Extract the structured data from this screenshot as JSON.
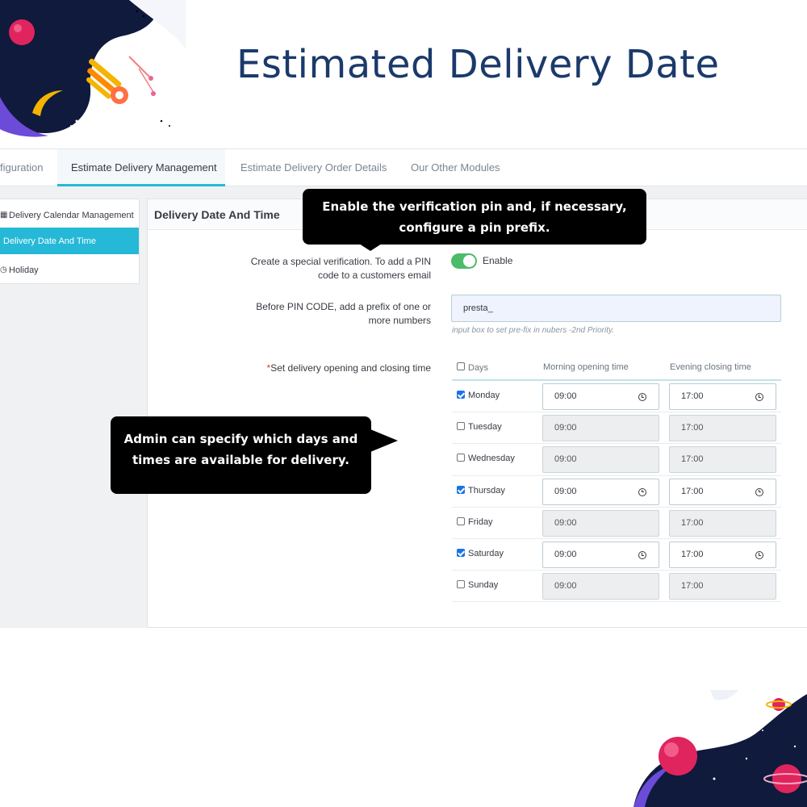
{
  "header": {
    "title": "Estimated Delivery Date"
  },
  "tabs": [
    {
      "label": "figuration",
      "active": false
    },
    {
      "label": "Estimate Delivery Management",
      "active": true
    },
    {
      "label": "Estimate Delivery Order Details",
      "active": false
    },
    {
      "label": "Our Other Modules",
      "active": false
    }
  ],
  "left_menu": [
    {
      "label": "Delivery Calendar Management",
      "icon": "calendar-icon",
      "active": false
    },
    {
      "label": "Delivery Date And Time",
      "icon": "",
      "active": true
    },
    {
      "label": "Holiday",
      "icon": "clock-icon",
      "active": false
    }
  ],
  "panel": {
    "title": "Delivery Date And Time",
    "verification": {
      "label_line1": "Create a special verification. To add a PIN",
      "label_line2": "code to a customers email",
      "toggle_text": "Enable",
      "enabled": true
    },
    "prefix": {
      "label_line1": "Before PIN CODE, add a prefix of one or",
      "label_line2": "more numbers",
      "value": "presta_",
      "help": "input box to set pre-fix in nubers -2nd Priority."
    },
    "schedule": {
      "required_mark": "*",
      "label": "Set delivery opening and closing time",
      "col_days": "Days",
      "col_morning": "Morning opening time",
      "col_evening": "Evening closing time",
      "days": [
        {
          "name": "Monday",
          "checked": true,
          "open": "09:00",
          "close": "17:00"
        },
        {
          "name": "Tuesday",
          "checked": false,
          "open": "09:00",
          "close": "17:00"
        },
        {
          "name": "Wednesday",
          "checked": false,
          "open": "09:00",
          "close": "17:00"
        },
        {
          "name": "Thursday",
          "checked": true,
          "open": "09:00",
          "close": "17:00"
        },
        {
          "name": "Friday",
          "checked": false,
          "open": "09:00",
          "close": "17:00"
        },
        {
          "name": "Saturday",
          "checked": true,
          "open": "09:00",
          "close": "17:00"
        },
        {
          "name": "Sunday",
          "checked": false,
          "open": "09:00",
          "close": "17:00"
        }
      ]
    }
  },
  "callouts": {
    "pin_line1": "Enable the verification pin and, if necessary,",
    "pin_line2": "configure a pin prefix.",
    "days_line1": "Admin can specify which days and",
    "days_line2": "times are available for delivery."
  },
  "colors": {
    "accent": "#25b9d7",
    "title": "#1b3a6b",
    "toggle_on": "#4cbb6c",
    "checkbox": "#1a73e8"
  }
}
